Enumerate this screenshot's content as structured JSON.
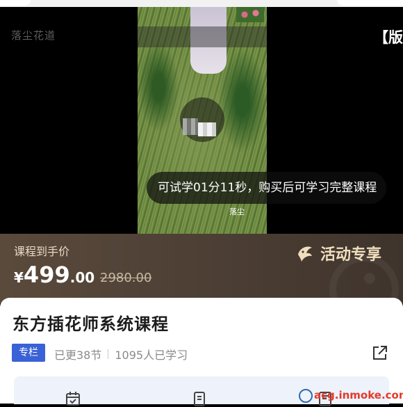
{
  "video": {
    "channel_name": "落尘花道",
    "edition_badge": "【版",
    "trial_notice": "可试学01分11秒，购买后可学习完整课程",
    "watermark": "落尘"
  },
  "price": {
    "label": "课程到手价",
    "currency": "¥",
    "integer": "499",
    "decimal": ".00",
    "original": "2980.00",
    "promo_label": "活动专享"
  },
  "course": {
    "title": "东方插花师系统课程",
    "tag": "专栏",
    "updated": "已更38节",
    "learners": "1095人已学习"
  },
  "site_watermark": "acg.inmoke.com",
  "colors": {
    "price_banner": "#4a3d33",
    "tag_blue": "#3a62d6",
    "promo_gold": "#f0dfbf",
    "watermark_red": "#e23a2a"
  }
}
